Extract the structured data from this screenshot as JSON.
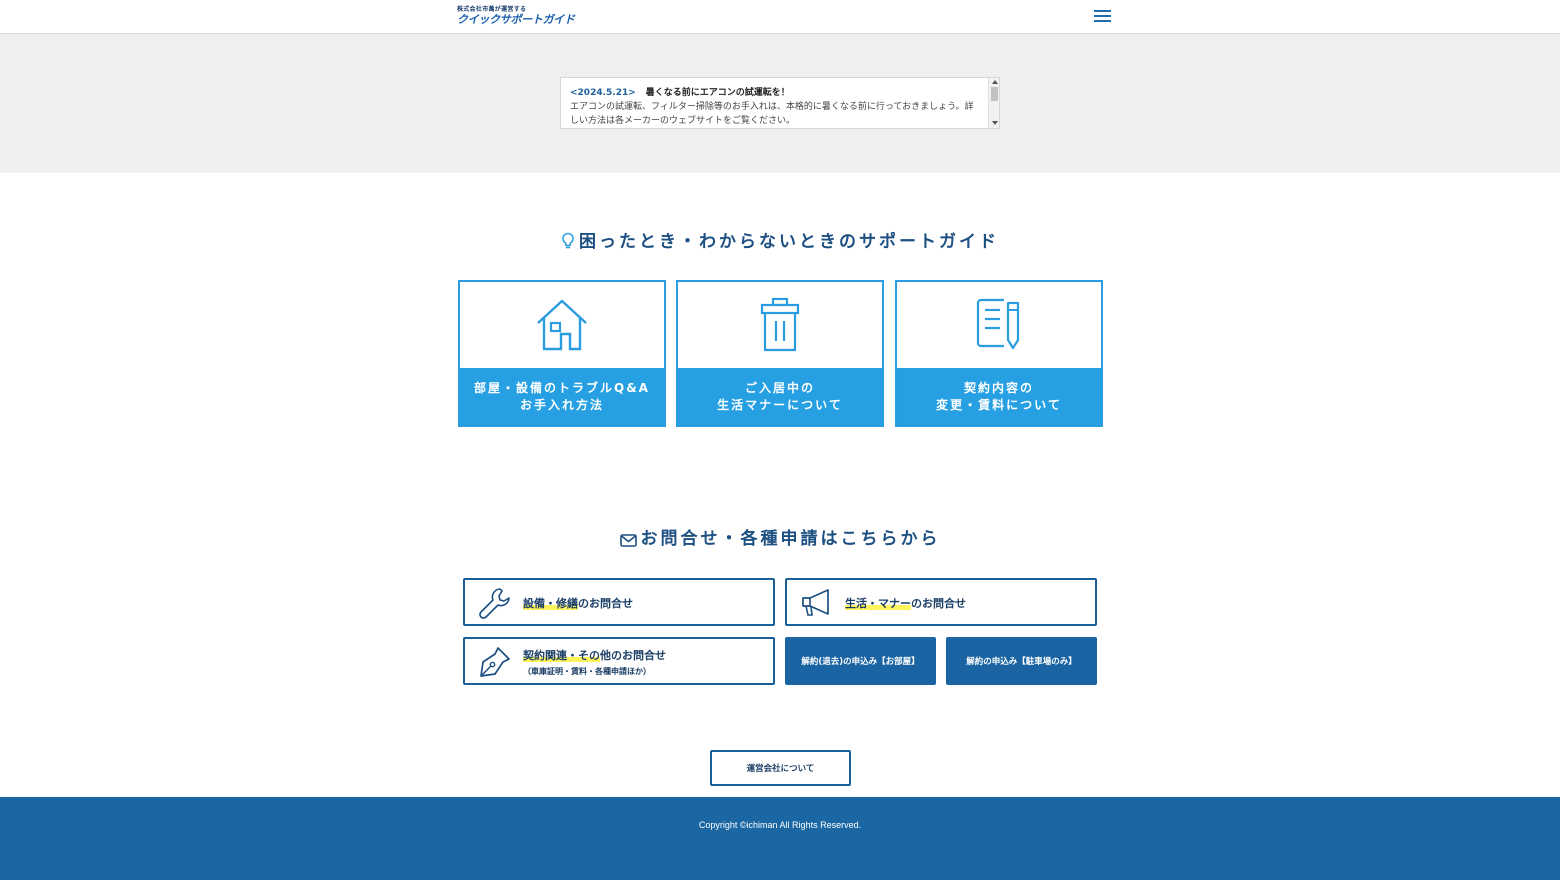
{
  "header": {
    "logo_sub": "株式会社市萬が運営する",
    "logo_main": "クイックサポートガイド"
  },
  "news": {
    "date": "<2024.5.21>",
    "title": "暑くなる前にエアコンの試運転を！",
    "body": "エアコンの試運転、フィルター掃除等のお手入れは、本格的に暑くなる前に行っておきましょう。詳しい方法は各メーカーのウェブサイトをご覧ください。"
  },
  "guide": {
    "title": "困ったとき・わからないときのサポートガイド",
    "cards": [
      {
        "line1": "部屋・設備のトラブルQ&A",
        "line2": "お手入れ方法",
        "icon": "house-icon"
      },
      {
        "line1": "ご入居中の",
        "line2": "生活マナーについて",
        "icon": "trash-can-icon"
      },
      {
        "line1": "契約内容の",
        "line2": "変更・賃料について",
        "icon": "document-pen-icon"
      }
    ]
  },
  "contact": {
    "title": "お問合せ・各種申請はこちらから",
    "equipment": {
      "highlight": "設備・修繕",
      "rest": "のお問合せ",
      "icon": "wrench-icon"
    },
    "life": {
      "highlight": "生活・マナー",
      "rest": "のお問合せ",
      "icon": "megaphone-icon"
    },
    "contract": {
      "highlight": "契約関連・その",
      "rest": "他のお問合せ",
      "sub": "（車庫証明・賃料・各種申請ほか）",
      "icon": "pen-nib-icon"
    },
    "cancel_room": "解約(退去)の申込み【お部屋】",
    "cancel_parking": "解約の申込み【駐車場のみ】"
  },
  "about_button": "運営会社について",
  "footer": {
    "copyright": "Copyright ©ichiman All Rights Reserved."
  },
  "colors": {
    "accent_blue": "#27a0e3",
    "navy": "#1a64a3",
    "footer": "#1b67a3",
    "highlight": "#fff45c"
  }
}
